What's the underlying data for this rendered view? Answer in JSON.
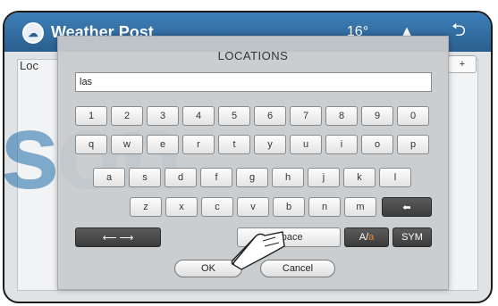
{
  "app": {
    "title": "Weather Post",
    "back_label": "⮌",
    "menu_label": "▲",
    "count_label": "16°"
  },
  "page": {
    "location_label": "Loc",
    "add_label": "+"
  },
  "watermark": "son",
  "dialog": {
    "title": "LOCATIONS",
    "input_value": "las",
    "ok_label": "OK",
    "cancel_label": "Cancel"
  },
  "keyboard": {
    "row1": [
      "1",
      "2",
      "3",
      "4",
      "5",
      "6",
      "7",
      "8",
      "9",
      "0"
    ],
    "row2": [
      "q",
      "w",
      "e",
      "r",
      "t",
      "y",
      "u",
      "i",
      "o",
      "p"
    ],
    "row3": [
      "a",
      "s",
      "d",
      "f",
      "g",
      "h",
      "j",
      "k",
      "l"
    ],
    "row4": [
      "z",
      "x",
      "c",
      "v",
      "b",
      "n",
      "m"
    ],
    "backspace_label": "⬅",
    "cursor_label": "⟵ ⟶",
    "space_label": "Space",
    "shift_label_upper": "A/",
    "shift_label_lower": "a",
    "sym_label": "SYM"
  },
  "colors": {
    "titlebar": "#2a5f8f",
    "shift_accent": "#f08a24"
  }
}
